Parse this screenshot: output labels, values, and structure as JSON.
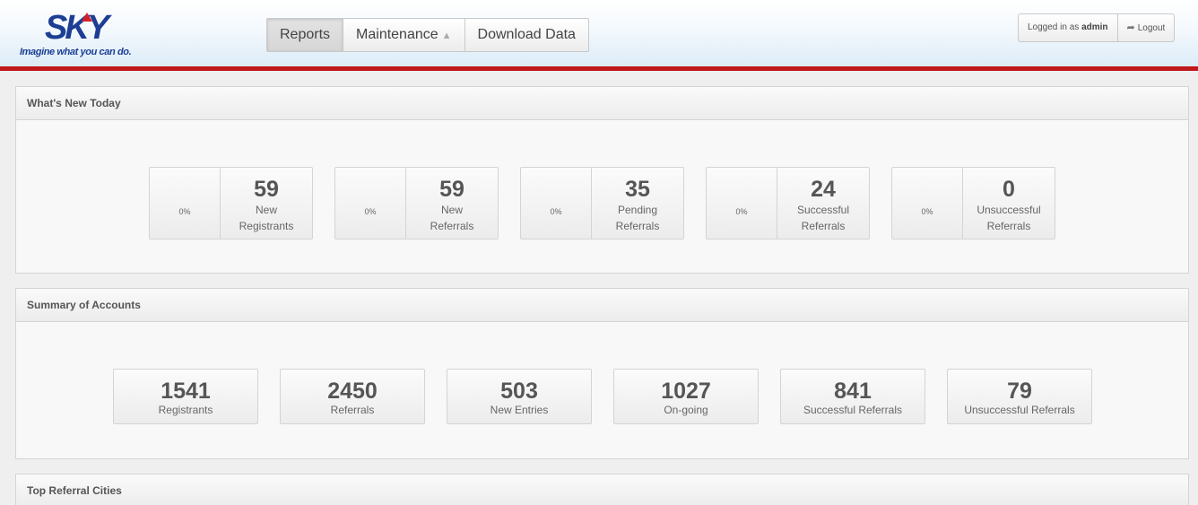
{
  "brand": {
    "logo_text": "SKY",
    "tagline": "Imagine what you can do."
  },
  "nav": {
    "reports": "Reports",
    "maintenance": "Maintenance",
    "maintenance_caret": "▲",
    "download": "Download Data"
  },
  "user": {
    "logged_in_prefix": "Logged in as",
    "username": "admin",
    "logout": "Logout"
  },
  "whats_new": {
    "title": "What's New Today",
    "cards": [
      {
        "percent": "0%",
        "value": "59",
        "label": "New Registrants"
      },
      {
        "percent": "0%",
        "value": "59",
        "label": "New Referrals"
      },
      {
        "percent": "0%",
        "value": "35",
        "label": "Pending Referrals"
      },
      {
        "percent": "0%",
        "value": "24",
        "label": "Successful Referrals"
      },
      {
        "percent": "0%",
        "value": "0",
        "label": "Unsuccessful Referrals"
      }
    ]
  },
  "summary": {
    "title": "Summary of Accounts",
    "cards": [
      {
        "value": "1541",
        "label": "Registrants"
      },
      {
        "value": "2450",
        "label": "Referrals"
      },
      {
        "value": "503",
        "label": "New Entries"
      },
      {
        "value": "1027",
        "label": "On-going"
      },
      {
        "value": "841",
        "label": "Successful Referrals"
      },
      {
        "value": "79",
        "label": "Unsuccessful Referrals"
      }
    ]
  },
  "top_cities": {
    "title": "Top Referral Cities"
  },
  "colors": {
    "brand_blue": "#1c3f94",
    "brand_red": "#c0171c"
  }
}
